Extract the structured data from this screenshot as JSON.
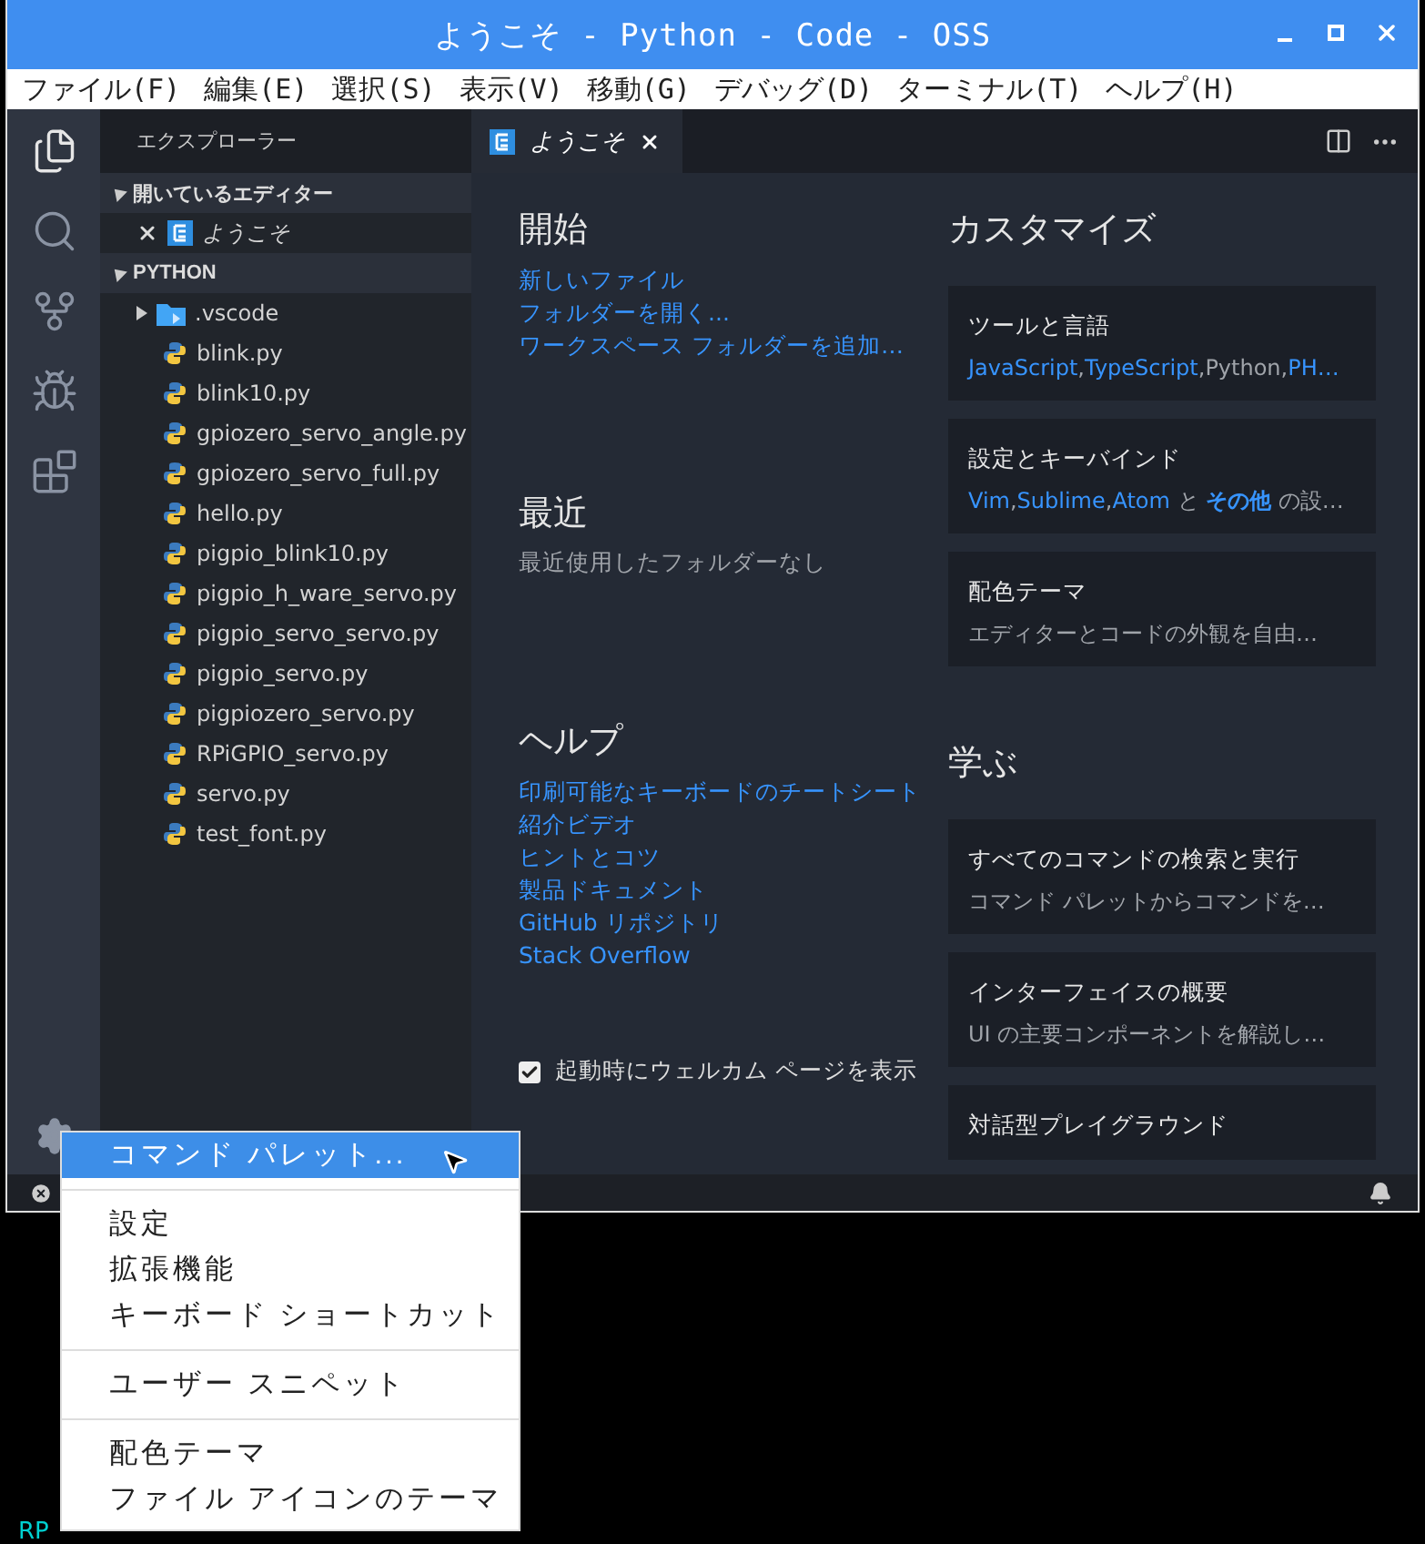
{
  "window": {
    "title": "ようこそ - Python - Code - OSS"
  },
  "menu_bar": [
    "ファイル(F)",
    "編集(E)",
    "選択(S)",
    "表示(V)",
    "移動(G)",
    "デバッグ(D)",
    "ターミナル(T)",
    "ヘルプ(H)"
  ],
  "activity_bar": [
    {
      "kind": "explorer",
      "selected": true
    },
    {
      "kind": "search",
      "selected": false
    },
    {
      "kind": "git",
      "selected": false
    },
    {
      "kind": "debug",
      "selected": false
    },
    {
      "kind": "extensions",
      "selected": false
    }
  ],
  "sidebar": {
    "title": "エクスプローラー",
    "open_editors": {
      "title": "開いているエディター",
      "expanded": true,
      "items": [
        {
          "label": "ようこそ"
        }
      ]
    },
    "folder": {
      "title": "PYTHON",
      "expanded": true,
      "items": [
        {
          "label": ".vscode",
          "kind": "folder",
          "expanded": false
        },
        {
          "label": "blink.py",
          "kind": "python"
        },
        {
          "label": "blink10.py",
          "kind": "python"
        },
        {
          "label": "gpiozero_servo_angle.py",
          "kind": "python"
        },
        {
          "label": "gpiozero_servo_full.py",
          "kind": "python"
        },
        {
          "label": "hello.py",
          "kind": "python"
        },
        {
          "label": "pigpio_blink10.py",
          "kind": "python"
        },
        {
          "label": "pigpio_h_ware_servo.py",
          "kind": "python"
        },
        {
          "label": "pigpio_servo_servo.py",
          "kind": "python"
        },
        {
          "label": "pigpio_servo.py",
          "kind": "python"
        },
        {
          "label": "pigpiozero_servo.py",
          "kind": "python"
        },
        {
          "label": "RPiGPIO_servo.py",
          "kind": "python"
        },
        {
          "label": "servo.py",
          "kind": "python"
        },
        {
          "label": "test_font.py",
          "kind": "python"
        }
      ]
    }
  },
  "tabs": [
    {
      "label": "ようこそ",
      "selected": true
    }
  ],
  "welcome": {
    "start": {
      "title": "開始",
      "links": [
        "新しいファイル",
        "フォルダーを開く...",
        "ワークスペース フォルダーを追加…"
      ]
    },
    "recent": {
      "title": "最近",
      "empty": "最近使用したフォルダーなし"
    },
    "help": {
      "title": "ヘルプ",
      "links": [
        "印刷可能なキーボードのチートシート",
        "紹介ビデオ",
        "ヒントとコツ",
        "製品ドキュメント",
        "GitHub リポジトリ",
        "Stack Overflow"
      ]
    },
    "show_on_startup": {
      "label": "起動時にウェルカム ページを表示",
      "checked": true
    },
    "customize": {
      "title": "カスタマイズ",
      "cards": [
        {
          "title": "ツールと言語",
          "separator": ",",
          "items": [
            {
              "text": "JavaScript",
              "link": true
            },
            {
              "text": "TypeScript",
              "link": true
            },
            {
              "text": "Python",
              "link": false
            },
            {
              "text": "PH…",
              "link": true
            }
          ]
        },
        {
          "title": "設定とキーバインド",
          "parts": [
            {
              "text": "Vim",
              "link": true
            },
            {
              "text": ",",
              "link": false
            },
            {
              "text": "Sublime",
              "link": true
            },
            {
              "text": ",",
              "link": false
            },
            {
              "text": "Atom",
              "link": true
            },
            {
              "text": " と ",
              "link": false
            },
            {
              "text": "その他",
              "link": true,
              "bold": true
            },
            {
              "text": " の設…",
              "link": false
            }
          ]
        },
        {
          "title": "配色テーマ",
          "parts": [
            {
              "text": "エディターとコードの外観を自由…",
              "link": false
            }
          ]
        }
      ]
    },
    "learn": {
      "title": "学ぶ",
      "cards": [
        {
          "title": "すべてのコマンドの検索と実行",
          "parts": [
            {
              "text": "コマンド パレットからコマンドを…",
              "link": false
            }
          ]
        },
        {
          "title": "インターフェイスの概要",
          "parts": [
            {
              "text": "UI の主要コンポーネントを解説し…",
              "link": false
            }
          ]
        },
        {
          "title": "対話型プレイグラウンド"
        }
      ]
    }
  },
  "context_menu": {
    "groups": [
      [
        {
          "label": "コマンド パレット...",
          "selected": true
        }
      ],
      [
        {
          "label": "設定",
          "selected": false
        },
        {
          "label": "拡張機能",
          "selected": false
        },
        {
          "label": "キーボード ショートカット",
          "selected": false
        }
      ],
      [
        {
          "label": "ユーザー スニペット",
          "selected": false
        }
      ],
      [
        {
          "label": "配色テーマ",
          "selected": false
        },
        {
          "label": "ファイル アイコンのテーマ",
          "selected": false
        }
      ]
    ]
  },
  "desktop_text": "RP"
}
